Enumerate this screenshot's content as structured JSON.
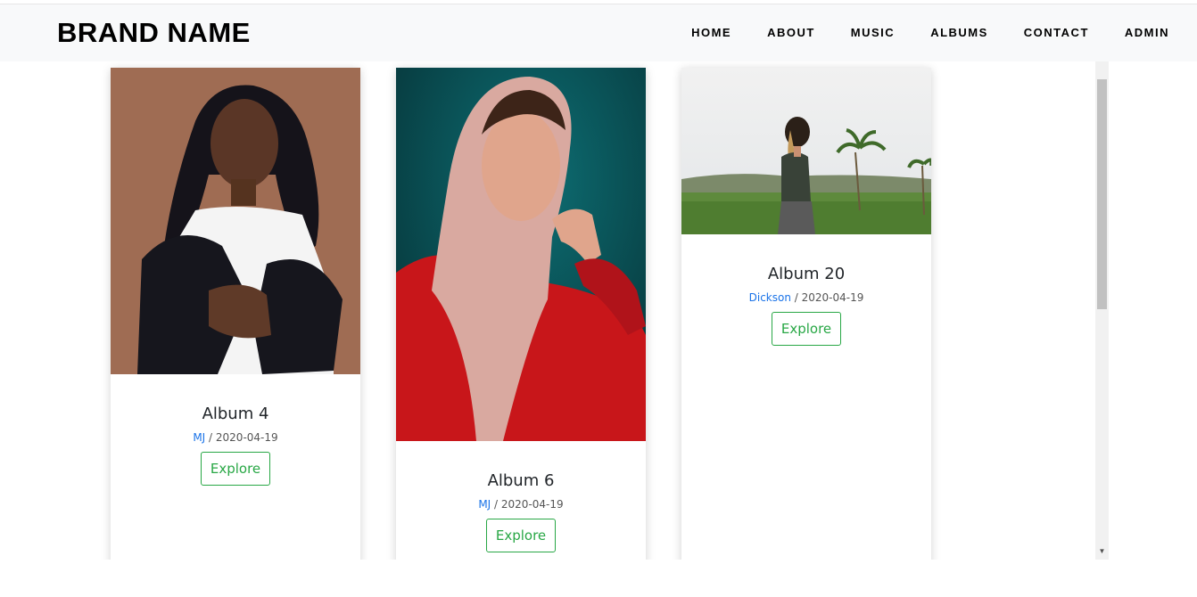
{
  "brand": "BRAND NAME",
  "nav": [
    "HOME",
    "ABOUT",
    "MUSIC",
    "ALBUMS",
    "CONTACT",
    "ADMIN"
  ],
  "albums": [
    {
      "title": "Album 4",
      "author": "MJ",
      "separator": " / ",
      "date": "2020-04-19",
      "button": "Explore"
    },
    {
      "title": "Album 6",
      "author": "MJ",
      "separator": " / ",
      "date": "2020-04-19",
      "button": "Explore"
    },
    {
      "title": "Album 20",
      "author": "Dickson",
      "separator": " / ",
      "date": "2020-04-19",
      "button": "Explore"
    }
  ],
  "colors": {
    "navbar_bg": "#f8f9fa",
    "author_link": "#1a73e8",
    "explore_button": "#28a745"
  },
  "icons": {
    "scroll_down": "triangle-down-icon"
  }
}
